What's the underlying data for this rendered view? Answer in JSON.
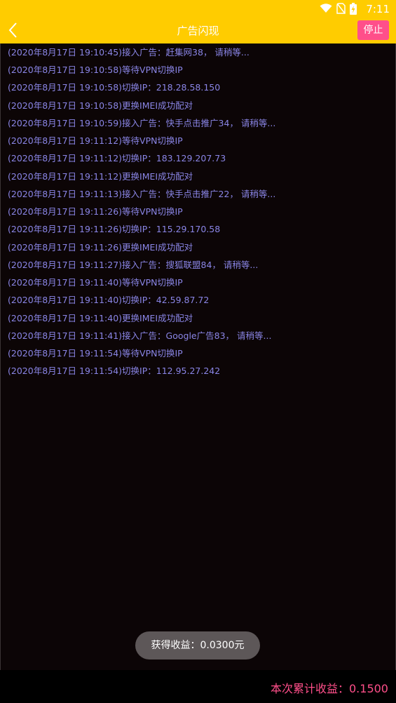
{
  "status_bar": {
    "time": "7:11",
    "icons": [
      "wifi-icon",
      "no-sim-icon",
      "battery-charging-icon"
    ]
  },
  "header": {
    "title": "广告闪现",
    "back_icon": "chevron-left-icon",
    "stop_label": "停止"
  },
  "log": {
    "lines": [
      "(2020年8月17日 19:10:45)接入广告：赶集网38， 请稍等...",
      "(2020年8月17日 19:10:58)等待VPN切换IP",
      "(2020年8月17日 19:10:58)切换IP：218.28.58.150",
      "(2020年8月17日 19:10:58)更换IMEI成功配对",
      "(2020年8月17日 19:10:59)接入广告：快手点击推广34， 请稍等...",
      "(2020年8月17日 19:11:12)等待VPN切换IP",
      "(2020年8月17日 19:11:12)切换IP：183.129.207.73",
      "(2020年8月17日 19:11:12)更换IMEI成功配对",
      "(2020年8月17日 19:11:13)接入广告：快手点击推广22， 请稍等...",
      "(2020年8月17日 19:11:26)等待VPN切换IP",
      "(2020年8月17日 19:11:26)切换IP：115.29.170.58",
      "(2020年8月17日 19:11:26)更换IMEI成功配对",
      "(2020年8月17日 19:11:27)接入广告：搜狐联盟84， 请稍等...",
      "(2020年8月17日 19:11:40)等待VPN切换IP",
      "(2020年8月17日 19:11:40)切换IP：42.59.87.72",
      "(2020年8月17日 19:11:40)更换IMEI成功配对",
      "(2020年8月17日 19:11:41)接入广告：Google广告83， 请稍等...",
      "(2020年8月17日 19:11:54)等待VPN切换IP",
      "(2020年8月17日 19:11:54)切换IP：112.95.27.242"
    ]
  },
  "toast": {
    "text": "获得收益：0.0300元"
  },
  "footer": {
    "total_text": "本次累计收益：0.1500"
  },
  "colors": {
    "header_bg": "#ffcc00",
    "accent": "#ff4f8a",
    "log_text": "#8a85e6",
    "background": "#0c0506"
  }
}
